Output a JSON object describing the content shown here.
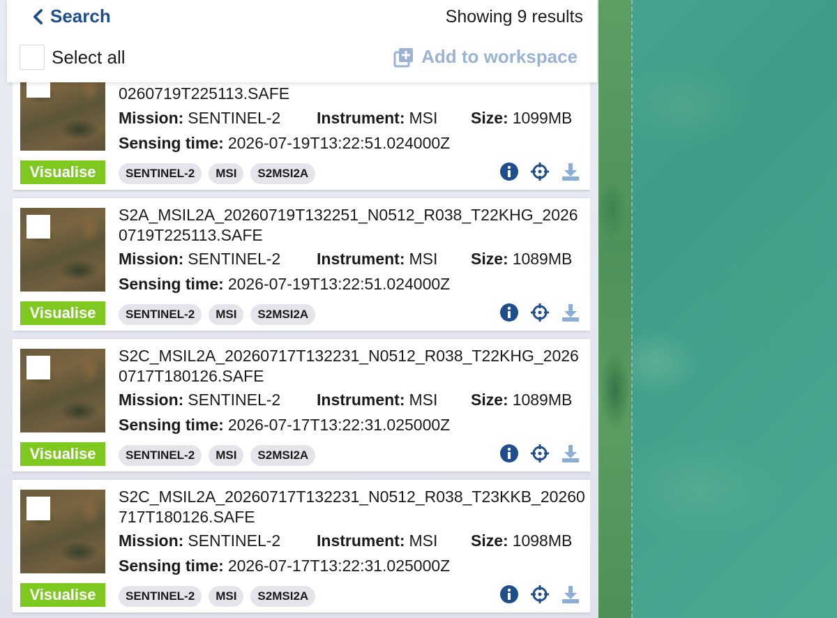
{
  "header": {
    "back_label": "Search",
    "results_text": "Showing 9 results",
    "select_all_label": "Select all",
    "add_to_workspace_label": "Add to workspace"
  },
  "labels": {
    "mission": "Mission:",
    "instrument": "Instrument:",
    "size": "Size:",
    "sensing_time": "Sensing time:",
    "visualise": "Visualise"
  },
  "results": [
    {
      "title": "0260719T225113.SAFE",
      "mission": "SENTINEL-2",
      "instrument": "MSI",
      "size": "1099MB",
      "sensing_time": "2026-07-19T13:22:51.024000Z",
      "tags": [
        "SENTINEL-2",
        "MSI",
        "S2MSI2A"
      ]
    },
    {
      "title": "S2A_MSIL2A_20260719T132251_N0512_R038_T22KHG_20260719T225113.SAFE",
      "mission": "SENTINEL-2",
      "instrument": "MSI",
      "size": "1089MB",
      "sensing_time": "2026-07-19T13:22:51.024000Z",
      "tags": [
        "SENTINEL-2",
        "MSI",
        "S2MSI2A"
      ]
    },
    {
      "title": "S2C_MSIL2A_20260717T132231_N0512_R038_T22KHG_20260717T180126.SAFE",
      "mission": "SENTINEL-2",
      "instrument": "MSI",
      "size": "1089MB",
      "sensing_time": "2026-07-17T13:22:31.025000Z",
      "tags": [
        "SENTINEL-2",
        "MSI",
        "S2MSI2A"
      ]
    },
    {
      "title": "S2C_MSIL2A_20260717T132231_N0512_R038_T23KKB_20260717T180126.SAFE",
      "mission": "SENTINEL-2",
      "instrument": "MSI",
      "size": "1098MB",
      "sensing_time": "2026-07-17T13:22:31.025000Z",
      "tags": [
        "SENTINEL-2",
        "MSI",
        "S2MSI2A"
      ]
    }
  ],
  "icons": {
    "back": "chevron-left-icon",
    "add_to_workspace": "add-layer-icon",
    "info": "info-icon",
    "locate": "crosshair-icon",
    "download": "download-icon"
  },
  "colors": {
    "primary": "#1f4e8c",
    "visualise": "#7ec81f",
    "disabled_action": "#9bb3d3",
    "download": "#8aaed6"
  }
}
